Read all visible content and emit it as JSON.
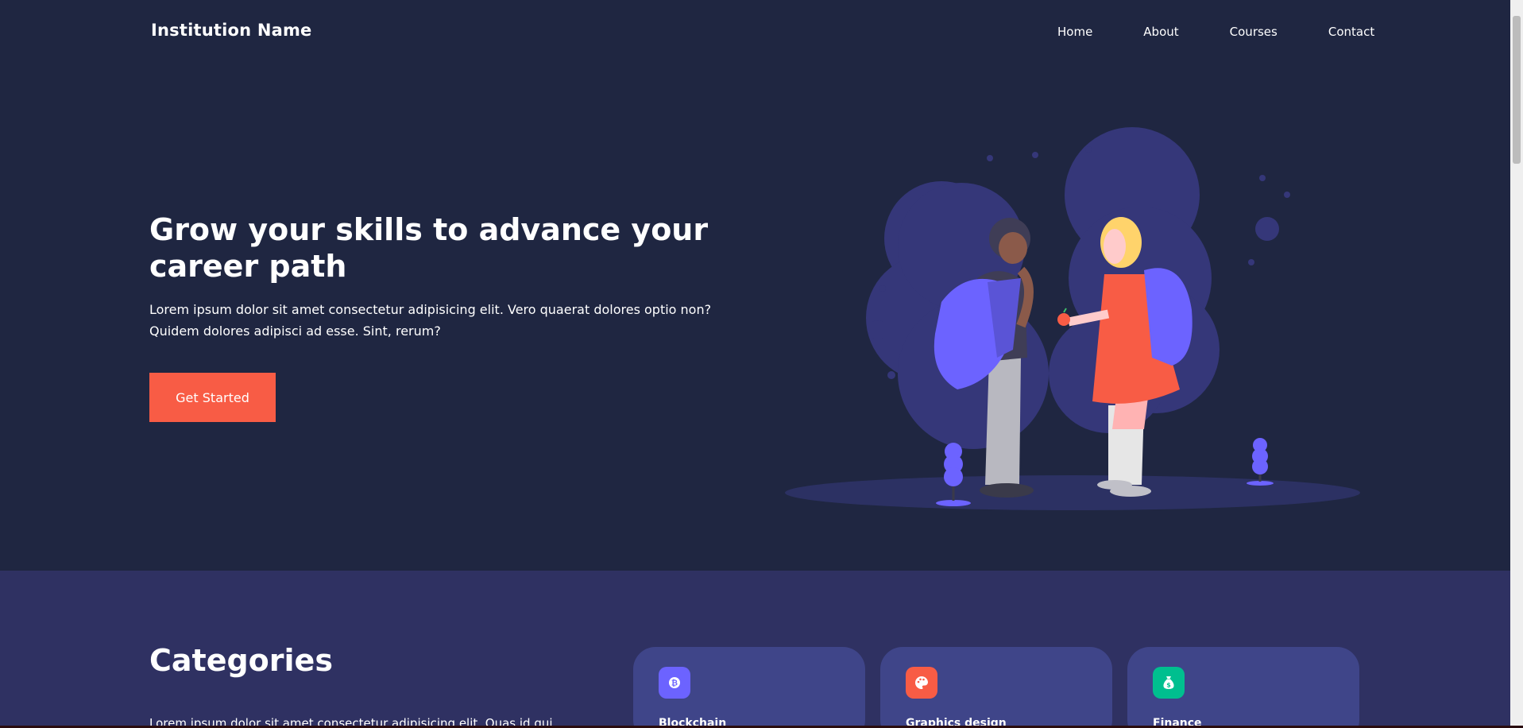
{
  "brand": "Institution Name",
  "nav": {
    "home": "Home",
    "about": "About",
    "courses": "Courses",
    "contact": "Contact"
  },
  "hero": {
    "title": "Grow your skills to advance your career path",
    "text": "Lorem ipsum dolor sit amet consectetur adipisicing elit. Vero quaerat dolores optio non? Quidem dolores adipisci ad esse. Sint, rerum?",
    "cta_label": "Get Started"
  },
  "categories": {
    "title": "Categories",
    "description": "Lorem ipsum dolor sit amet consectetur adipisicing elit. Quas id qui",
    "cards": [
      {
        "name": "Blockchain",
        "icon": "bitcoin-icon",
        "color": "#6c63ff"
      },
      {
        "name": "Graphics design",
        "icon": "palette-icon",
        "color": "#f85c45"
      },
      {
        "name": "Finance",
        "icon": "money-bag-icon",
        "color": "#00bf8f"
      }
    ]
  },
  "colors": {
    "hero_bg": "#1f2641",
    "categories_bg": "#2f3162",
    "card_bg": "#3f4589",
    "accent": "#f85c45",
    "illustration_purple": "#6c63ff"
  }
}
